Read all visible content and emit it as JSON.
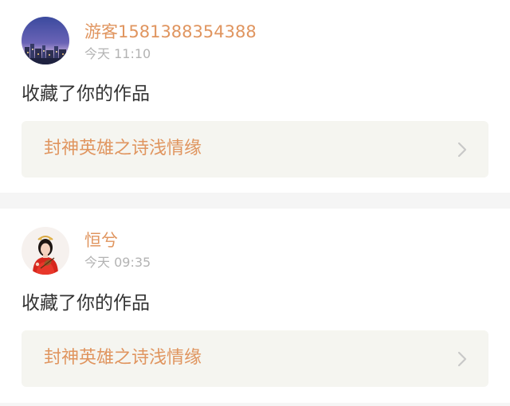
{
  "notifications": [
    {
      "username": "游客1581388354388",
      "time": "今天 11:10",
      "action": "收藏了你的作品",
      "work_title": "封神英雄之诗浅情缘"
    },
    {
      "username": "恒兮",
      "time": "今天 09:35",
      "action": "收藏了你的作品",
      "work_title": "封神英雄之诗浅情缘"
    }
  ],
  "colors": {
    "accent": "#e0955f",
    "card_bg": "#f5f5f0",
    "time": "#b3b3b3",
    "text": "#333333"
  },
  "icons": [
    "avatar-city-night",
    "avatar-woman-red-dress",
    "chevron-right-icon"
  ]
}
